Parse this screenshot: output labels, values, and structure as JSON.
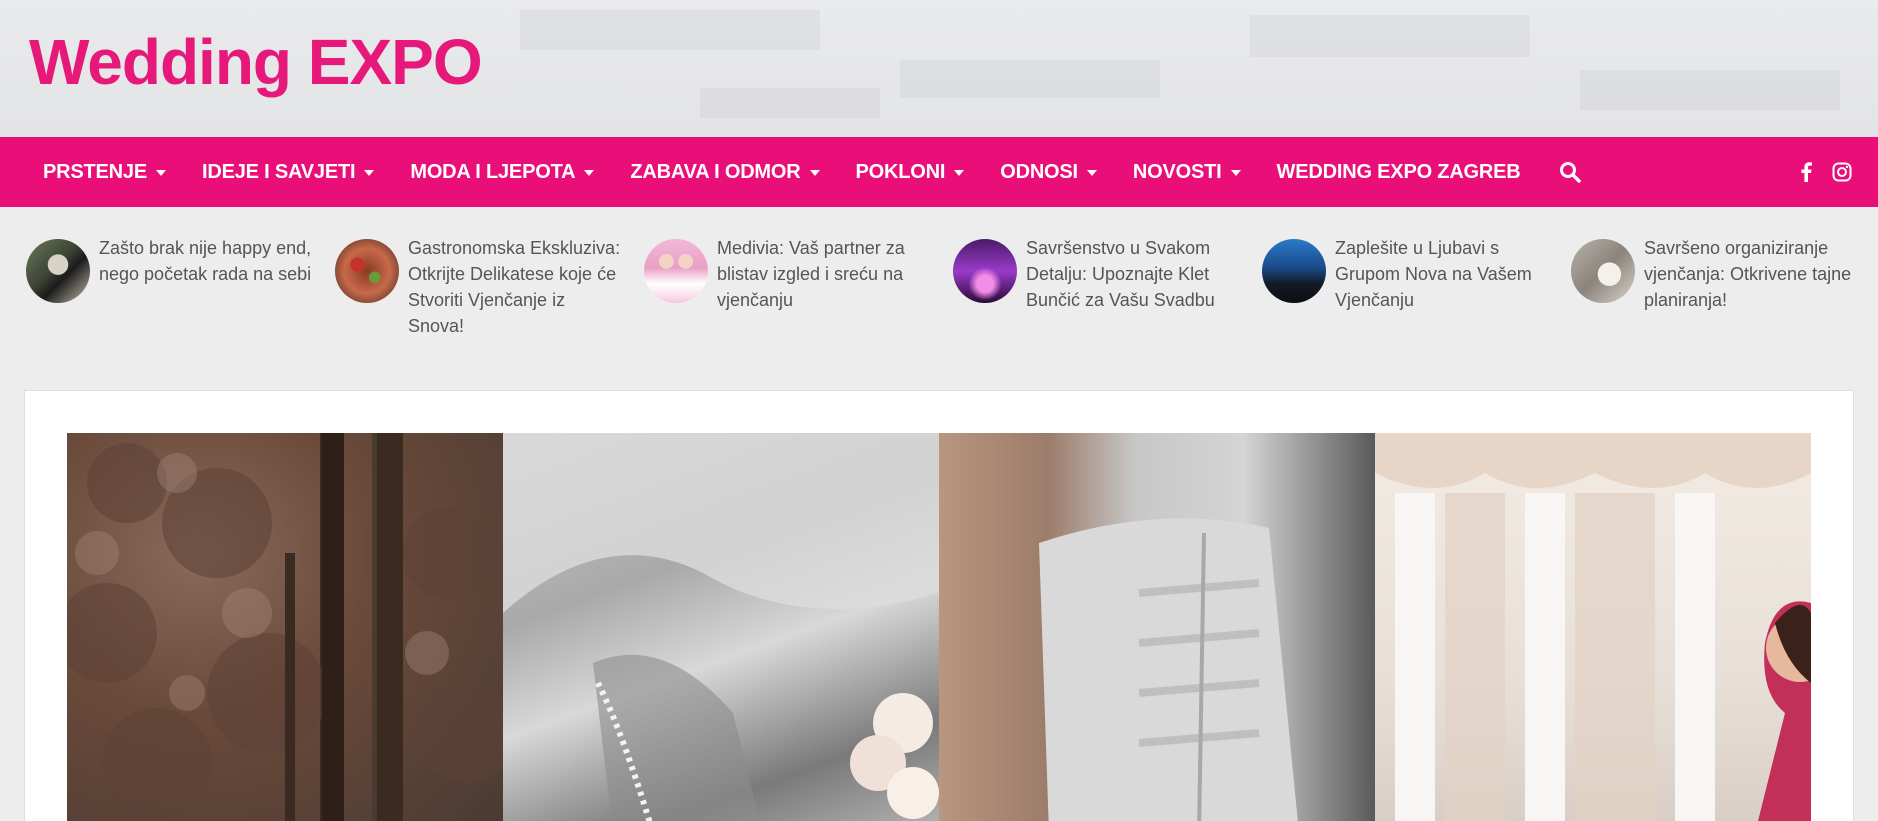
{
  "brand": {
    "logo_part1": "Wedding",
    "logo_part2": "EXPO",
    "logo_color": "#e6197a"
  },
  "nav": {
    "background": "#ea0e79",
    "items": [
      {
        "label": "PRSTENJE",
        "has_dropdown": true
      },
      {
        "label": "IDEJE I SAVJETI",
        "has_dropdown": true
      },
      {
        "label": "MODA I LJEPOTA",
        "has_dropdown": true
      },
      {
        "label": "ZABAVA I ODMOR",
        "has_dropdown": true
      },
      {
        "label": "POKLONI",
        "has_dropdown": true
      },
      {
        "label": "ODNOSI",
        "has_dropdown": true
      },
      {
        "label": "NOVOSTI",
        "has_dropdown": true
      },
      {
        "label": "WEDDING EXPO ZAGREB",
        "has_dropdown": false
      }
    ],
    "search_icon": "search-icon",
    "social": [
      "facebook-icon",
      "instagram-icon"
    ]
  },
  "featured": [
    {
      "title": "Zašto brak nije happy end, nego početak rada na sebi"
    },
    {
      "title": "Gastronomska Ekskluziva: Otkrijte Delikatese koje će Stvoriti Vjenčanje iz Snova!"
    },
    {
      "title": "Medivia: Vaš partner za blistav izgled i sreću na vjenčanju"
    },
    {
      "title": "Savršenstvo u Svakom Detalju: Upoznajte Klet Bunčić za Vašu Svadbu"
    },
    {
      "title": "Zaplešite u Ljubavi s Grupom Nova na Vašem Vjenčanju"
    },
    {
      "title": "Savršeno organiziranje vjenčanja: Otkrivene tajne planiranja!"
    }
  ]
}
